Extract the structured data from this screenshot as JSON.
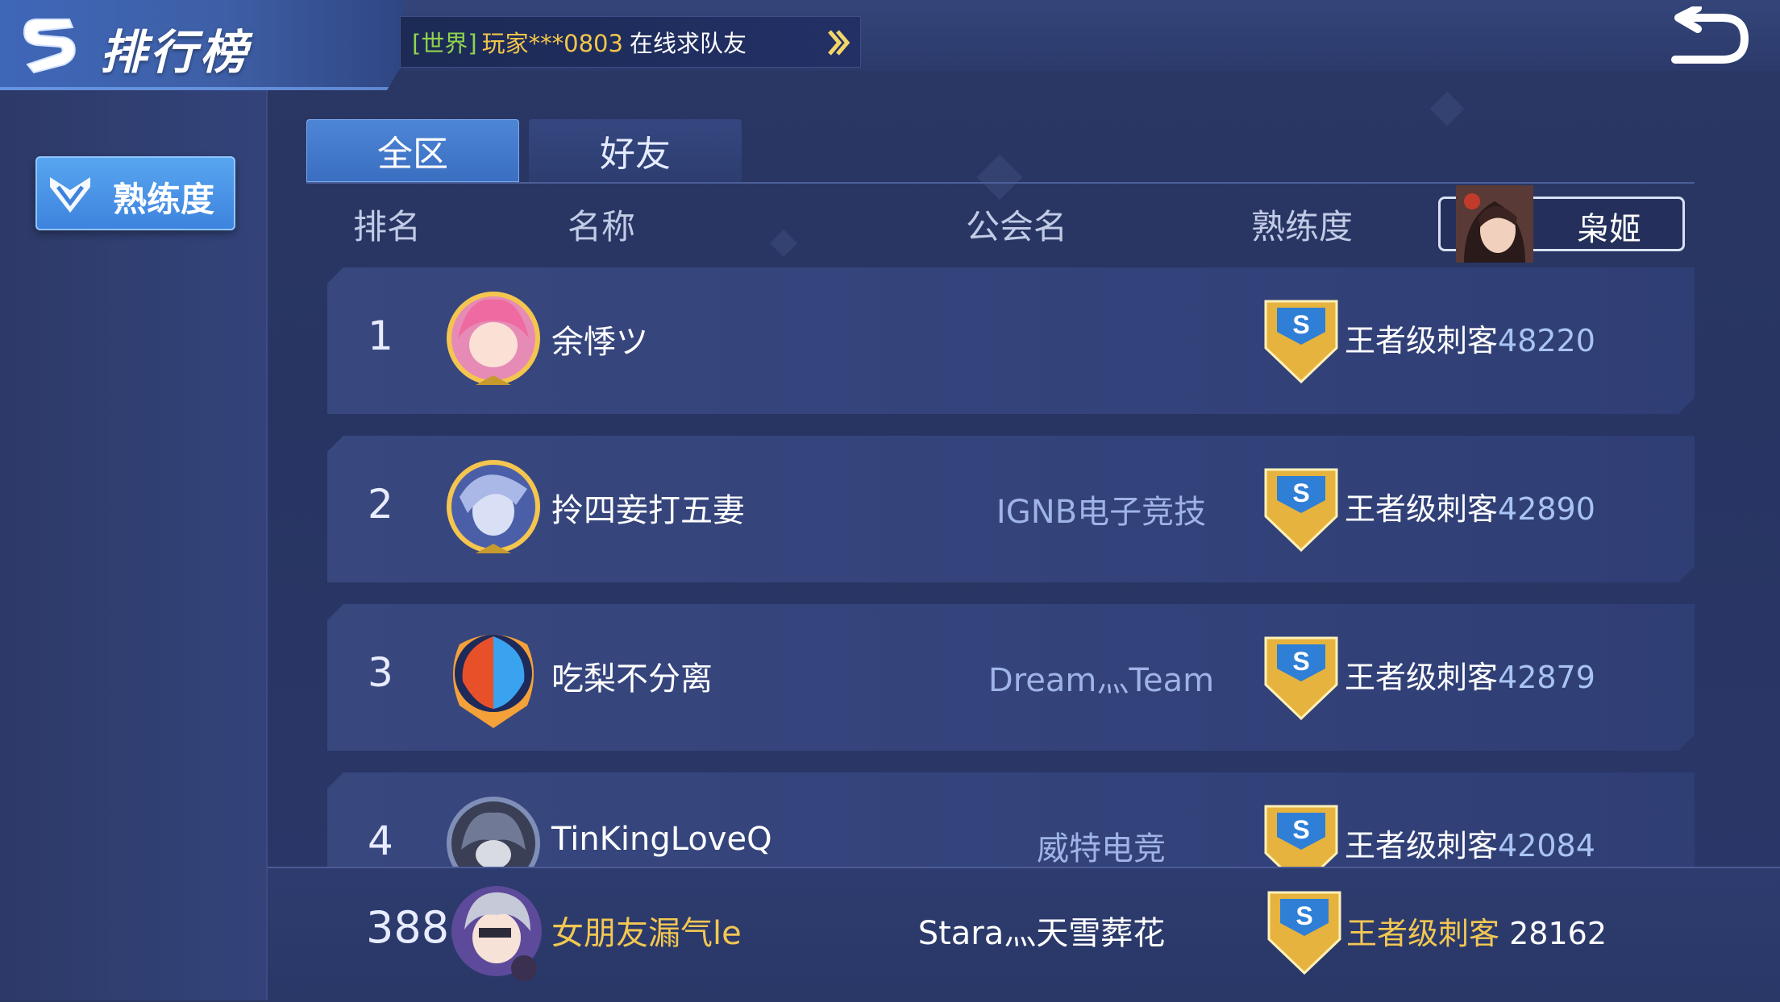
{
  "header": {
    "title": "排行榜",
    "notice": {
      "tag": "[世界]",
      "player": "玩家***0803",
      "message": "在线求队友"
    }
  },
  "sidebar": {
    "items": [
      {
        "label": "熟练度",
        "active": true
      }
    ]
  },
  "tabs": [
    {
      "label": "全区",
      "active": true
    },
    {
      "label": "好友",
      "active": false
    }
  ],
  "columns": {
    "rank": "排名",
    "name": "名称",
    "guild": "公会名",
    "proficiency": "熟练度"
  },
  "hero_filter": {
    "name": "枭姬"
  },
  "rows": [
    {
      "rank": "1",
      "name": "余悸ツ",
      "guild": "",
      "title": "王者级刺客",
      "score": "48220"
    },
    {
      "rank": "2",
      "name": "拎四妾打五妻",
      "guild": "IGNB电子竞技",
      "title": "王者级刺客",
      "score": "42890"
    },
    {
      "rank": "3",
      "name": "吃梨不分离",
      "guild": "Dream灬Team",
      "title": "王者级刺客",
      "score": "42879"
    },
    {
      "rank": "4",
      "name": "TinKingLoveQ",
      "guild": "威特电竞",
      "title": "王者级刺客",
      "score": "42084"
    }
  ],
  "my_rank": {
    "rank": "388",
    "name": "女朋友漏气le",
    "guild": "Stara灬天雪葬花",
    "title": "王者级刺客",
    "score": "28162"
  },
  "colors": {
    "accent_blue": "#4e86d6",
    "gold": "#f2c752",
    "green_tag": "#8fd44e",
    "score_blue": "#a9c4f2"
  }
}
